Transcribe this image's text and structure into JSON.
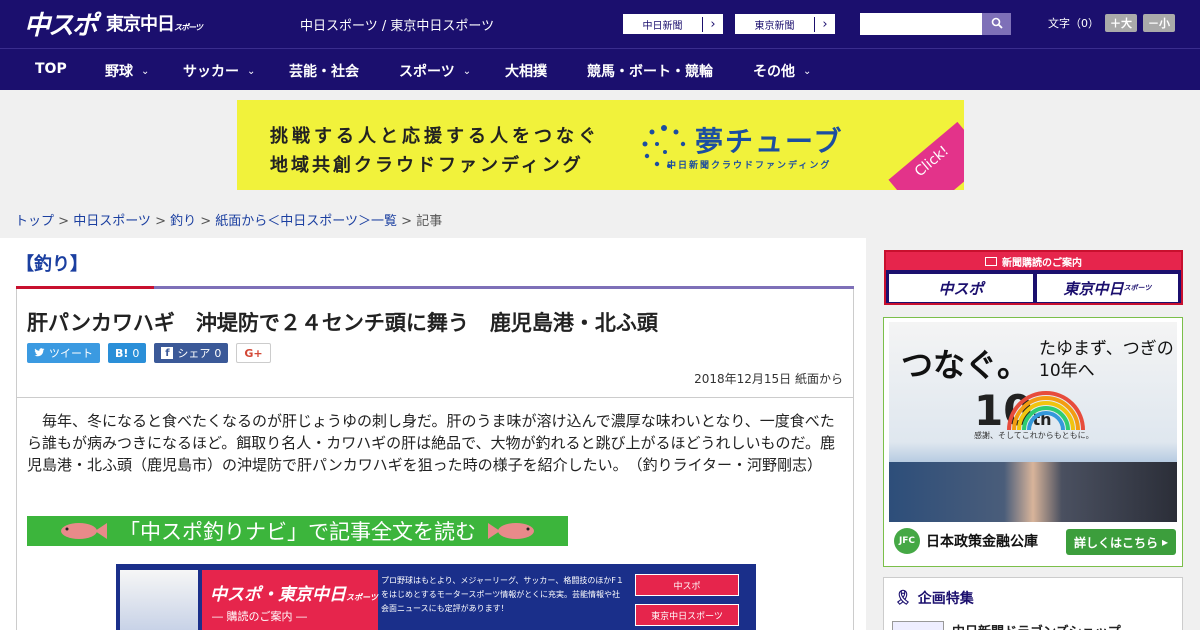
{
  "header": {
    "logo_main": "中スポ",
    "logo_sub": "東京中日",
    "logo_sub_small": "スポーツ",
    "site_name": "中日スポーツ / 東京中日スポーツ",
    "paper_buttons": [
      {
        "label": "中日新聞",
        "arrow": "›"
      },
      {
        "label": "東京新聞",
        "arrow": "›"
      }
    ],
    "search": {
      "placeholder": "",
      "button_icon": "search-icon"
    },
    "font_size": {
      "label": "文字（0）",
      "bigger": "＋大",
      "smaller": "－小"
    }
  },
  "nav": {
    "items": [
      {
        "label": "TOP",
        "has_dropdown": false
      },
      {
        "label": "野球",
        "has_dropdown": true
      },
      {
        "label": "サッカー",
        "has_dropdown": true
      },
      {
        "label": "芸能・社会",
        "has_dropdown": false
      },
      {
        "label": "スポーツ",
        "has_dropdown": true
      },
      {
        "label": "大相撲",
        "has_dropdown": false
      },
      {
        "label": "競馬・ボート・競輪",
        "has_dropdown": false
      },
      {
        "label": "その他",
        "has_dropdown": true
      }
    ],
    "chevron": "⌄"
  },
  "banner": {
    "line1": "挑戦する人と応援する人をつなぐ",
    "line2": "地域共創クラウドファンディング",
    "brand": "夢チューブ",
    "brand_sub": "中日新聞クラウドファンディング",
    "click": "Click!",
    "bg_color": "#f1f23b"
  },
  "breadcrumb": {
    "items": [
      "トップ",
      "中日スポーツ",
      "釣り",
      "紙面から＜中日スポーツ＞一覧"
    ],
    "current": "記事",
    "separator": " > "
  },
  "article": {
    "category": "【釣り】",
    "title": "肝パンカワハギ　沖堤防で２４センチ頭に舞う　鹿児島港・北ふ頭",
    "share": {
      "tweet": "ツイート",
      "hatena": "B!",
      "hatena_count": "0",
      "facebook": "シェア",
      "facebook_count": "0",
      "gplus": "G+"
    },
    "date": "2018年12月15日 紙面から",
    "body": "毎年、冬になると食べたくなるのが肝じょうゆの刺し身だ。肝のうま味が溶け込んで濃厚な味わいとなり、一度食べたら誰もが病みつきになるほど。餌取り名人・カワハギの肝は絶品で、大物が釣れると跳び上がるほどうれしいものだ。鹿児島港・北ふ頭（鹿児島市）の沖堤防で肝パンカワハギを狙った時の様子を紹介したい。　（釣りライター・河野剛志）",
    "navi_link": "「中スポ釣りナビ」で記事全文を読む",
    "sub_banner": {
      "title": "中スポ・東京中日",
      "title_small": "スポーツ",
      "subtitle": "― 購読のご案内 ―",
      "text": "プロ野球はもとより、メジャーリーグ、サッカー、格闘技のほかF１をはじめとするモータースポーツ情報がとくに充実。芸能情報や社会面ニュースにも定評があります！",
      "buttons": [
        "中スポ",
        "東京中日スポーツ"
      ]
    }
  },
  "sidebar": {
    "subscribe": {
      "head": "新聞購読のご案内",
      "btn1": "中スポ",
      "btn2": "東京中日",
      "btn2_small": "スポーツ"
    },
    "ad": {
      "copy_big": "つなぐ。",
      "copy_right": "たゆまず、つぎの10年へ",
      "ten": "10",
      "th": "th",
      "tagline": "感謝、そしてこれからもともに。",
      "company": "日本政策金融公庫",
      "logo": "JFC",
      "more": "詳しくはこちら",
      "more_arrow": "▸"
    },
    "feature": {
      "heading": "企画特集",
      "item": "中日新聞ドラゴンズショップ"
    }
  },
  "colors": {
    "navy": "#1b0f6e",
    "accent_red": "#c8102e",
    "purple": "#7e70b8",
    "link_blue": "#1b3fa0",
    "navi_green": "#3cb53c"
  }
}
